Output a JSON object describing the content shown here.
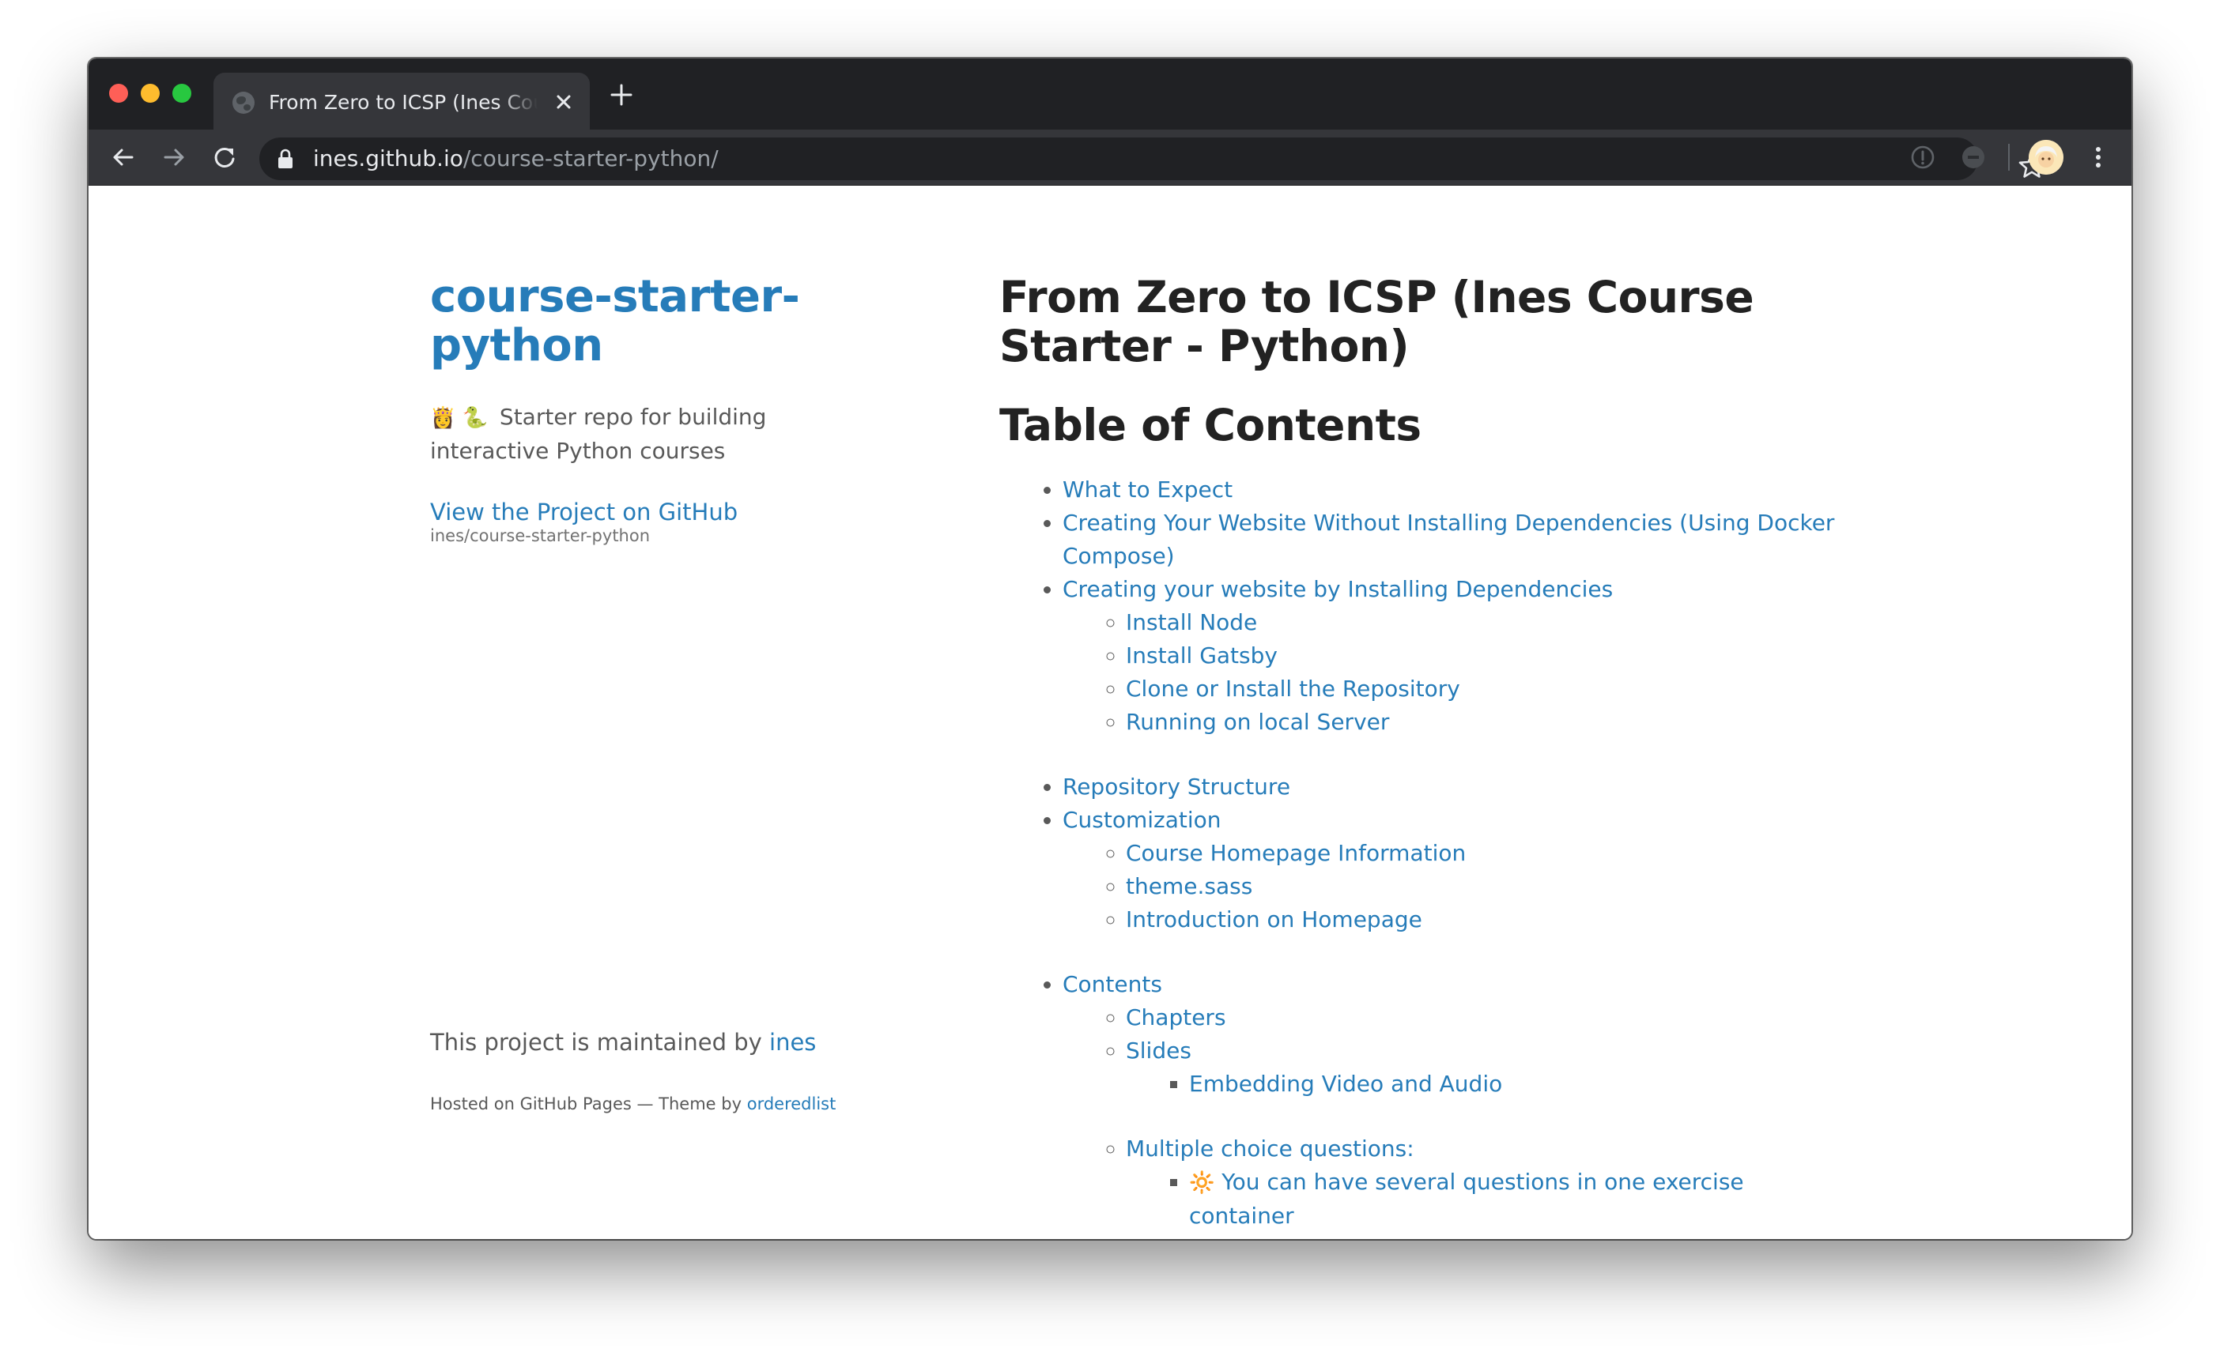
{
  "browser": {
    "tab": {
      "title": "From Zero to ICSP (Ines Course Starter - Python)"
    },
    "address_bar": {
      "host": "ines.github.io",
      "path": "/course-starter-python/"
    },
    "icons": {
      "back": "arrow-left-icon",
      "forward": "arrow-right-icon",
      "reload": "reload-icon",
      "lock": "lock-icon",
      "star": "star-icon",
      "menu": "kebab-menu-icon"
    },
    "colors": {
      "chrome_dark": "#202124",
      "chrome_toolbar": "#35363a",
      "close": "#fe5f57",
      "minimize": "#febc2e",
      "maximize": "#28c840"
    }
  },
  "page": {
    "sidebar": {
      "title": "course-starter-python",
      "description_emojis": "👸 🐍",
      "description": "Starter repo for building interactive Python courses",
      "github_link": "View the Project on GitHub",
      "github_repo": "ines/course-starter-python",
      "maintained_prefix": "This project is maintained by",
      "maintainer": "ines",
      "hosted_prefix": "Hosted on GitHub Pages — Theme by",
      "theme_author": "orderedlist"
    },
    "main": {
      "heading": "From Zero to ICSP (Ines Course Starter - Python)",
      "toc_heading": "Table of Contents",
      "toc": [
        {
          "label": "What to Expect"
        },
        {
          "label": "Creating Your Website Without Installing Dependencies (Using Docker Compose)"
        },
        {
          "label": "Creating your website by Installing Dependencies",
          "children": [
            {
              "label": "Install Node"
            },
            {
              "label": "Install Gatsby"
            },
            {
              "label": "Clone or Install the Repository"
            },
            {
              "label": "Running on local Server"
            }
          ]
        },
        {
          "label": "Repository Structure"
        },
        {
          "label": "Customization",
          "children": [
            {
              "label": "Course Homepage Information"
            },
            {
              "label": "theme.sass"
            },
            {
              "label": "Introduction on Homepage"
            }
          ]
        },
        {
          "label": "Contents",
          "children": [
            {
              "label": "Chapters"
            },
            {
              "label": "Slides",
              "children": [
                {
                  "label": "Embedding Video and Audio"
                }
              ]
            },
            {
              "label": "Multiple choice questions:",
              "children": [
                {
                  "emoji": "🔆",
                  "label": "You can have several questions in one exercise container"
                }
              ]
            }
          ]
        }
      ]
    },
    "colors": {
      "link": "#267CB9",
      "text": "#595959",
      "heading": "#222222"
    }
  }
}
